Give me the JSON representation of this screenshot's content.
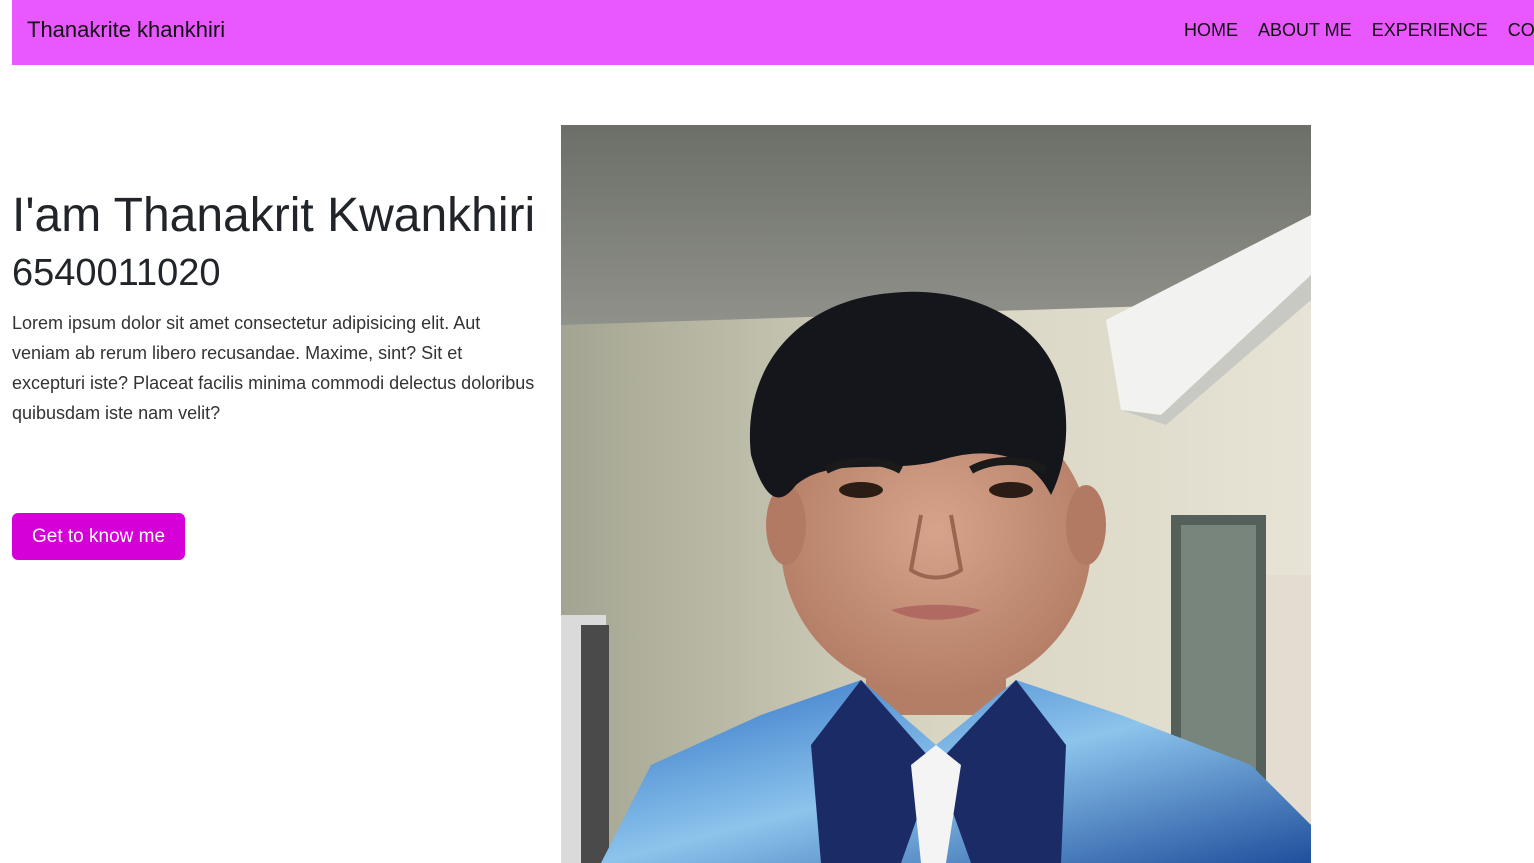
{
  "navbar": {
    "brand": "Thanakrite khankhiri",
    "items": [
      "HOME",
      "ABOUT ME",
      "EXPERIENCE",
      "CONTACT"
    ],
    "background": "#e957ff"
  },
  "hero": {
    "title": "I'am Thanakrit Kwankhiri",
    "student_id": "6540011020",
    "description": "Lorem ipsum dolor sit amet consectetur adipisicing elit. Aut veniam ab rerum libero recusandae. Maxime, sint? Sit et excepturi iste? Placeat facilis minima commodi delectus doloribus quibusdam iste nam velit?",
    "button_label": "Get to know me",
    "button_color": "#d500d8"
  },
  "photo": {
    "subject": "portrait photo of a young man in a blue patterned polo shirt in a room with an air conditioner"
  }
}
